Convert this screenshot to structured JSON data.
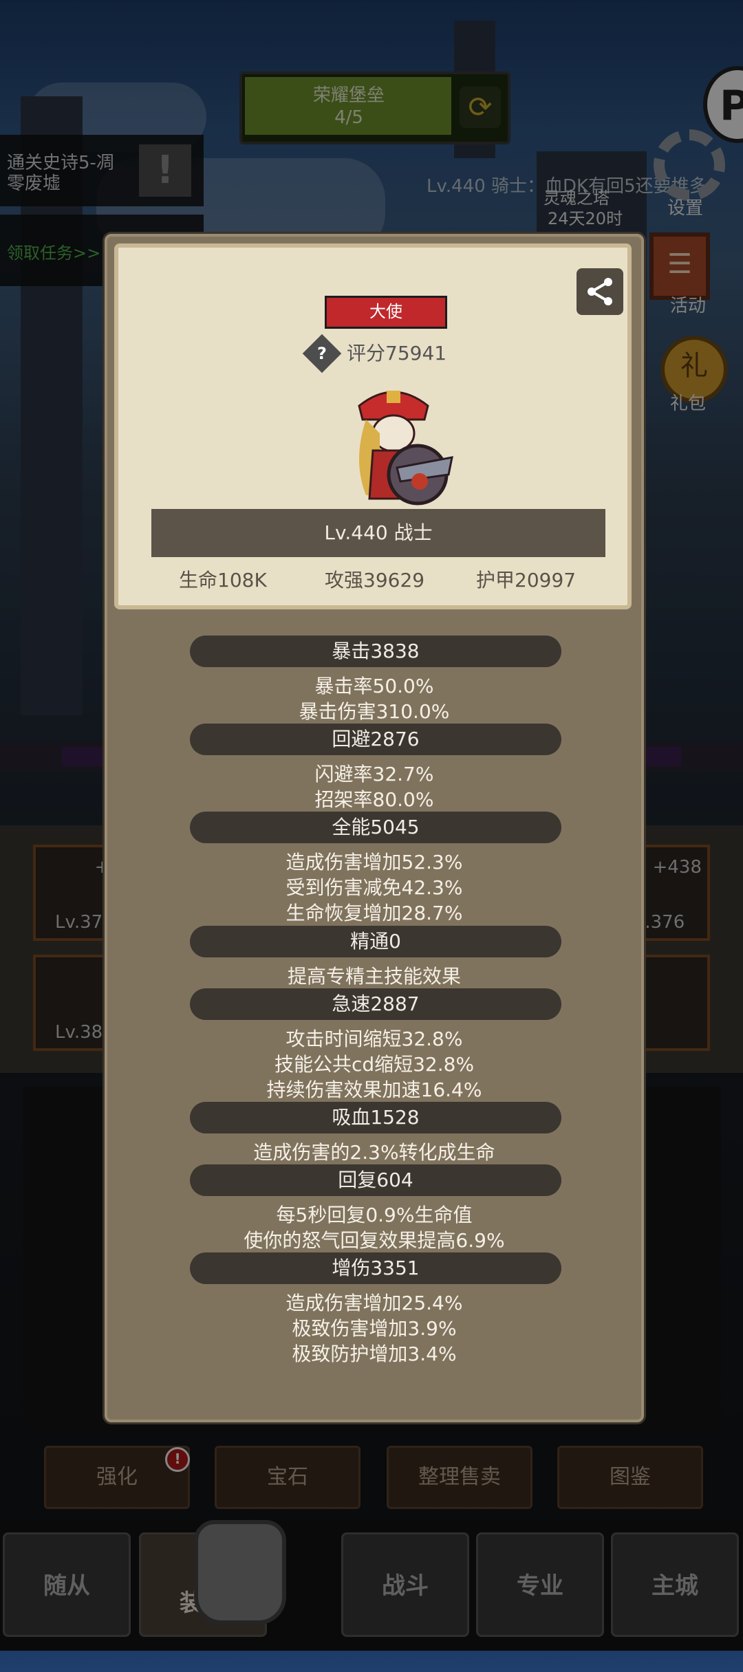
{
  "background": {
    "quest_banner": {
      "title": "荣耀堡垒",
      "progress": "4/5"
    },
    "side_quest": {
      "line1": "通关史诗5-凋",
      "line2": "零废墟",
      "icon": "exclamation-icon"
    },
    "task_link": "领取任务>>",
    "chat": "Lv.440 骑士：血DK有回5还要堆多",
    "dungeon": {
      "label": "灵魂之塔",
      "timer": "24天20时"
    },
    "menu": {
      "settings": "设置",
      "activity": "活动",
      "gift": "礼包"
    },
    "equip_slots": [
      {
        "plus": "+4",
        "level": "Lv.376"
      },
      {
        "plus": "+438",
        "level": "v.376"
      },
      {
        "plus": "",
        "level": "Lv.384"
      }
    ],
    "actions": [
      "强化",
      "宝石",
      "整理售卖",
      "图鉴"
    ],
    "nav": [
      "随从",
      "装备",
      "战斗",
      "专业",
      "主城"
    ]
  },
  "popup": {
    "title_tag": "大使",
    "score": "评分75941",
    "name_bar": "Lv.440 战士",
    "hp": "生命108K",
    "attack": "攻强39629",
    "armor": "护甲20997",
    "sections": [
      {
        "header": "暴击3838",
        "lines": [
          "暴击率50.0%",
          "暴击伤害310.0%"
        ]
      },
      {
        "header": "回避2876",
        "lines": [
          "闪避率32.7%",
          "招架率80.0%"
        ]
      },
      {
        "header": "全能5045",
        "lines": [
          "造成伤害增加52.3%",
          "受到伤害减免42.3%",
          "生命恢复增加28.7%"
        ]
      },
      {
        "header": "精通0",
        "lines": [
          "提高专精主技能效果"
        ]
      },
      {
        "header": "急速2887",
        "lines": [
          "攻击时间缩短32.8%",
          "技能公共cd缩短32.8%",
          "持续伤害效果加速16.4%"
        ]
      },
      {
        "header": "吸血1528",
        "lines": [
          "造成伤害的2.3%转化成生命"
        ]
      },
      {
        "header": "回复604",
        "lines": [
          "每5秒回复0.9%生命值",
          "使你的怒气回复效果提高6.9%"
        ]
      },
      {
        "header": "增伤3351",
        "lines": [
          "造成伤害增加25.4%",
          "极致伤害增加3.9%",
          "极致防护增加3.4%"
        ]
      }
    ]
  }
}
